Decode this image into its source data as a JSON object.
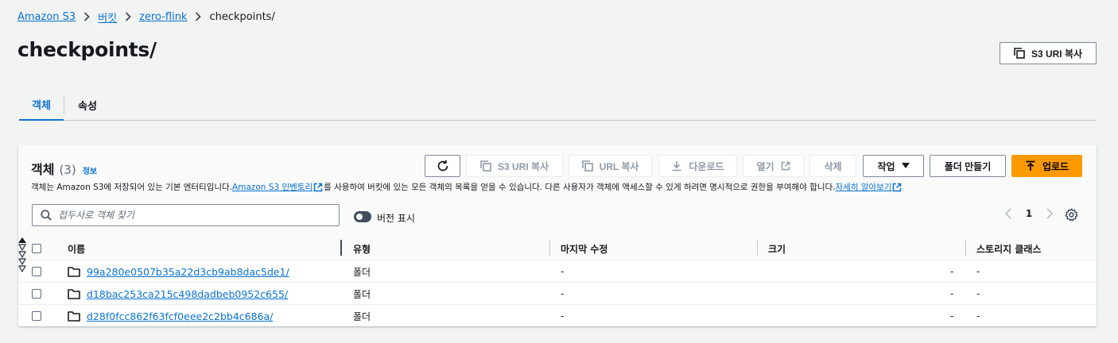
{
  "breadcrumb": [
    {
      "label": "Amazon S3",
      "link": true
    },
    {
      "label": "버킷",
      "link": true
    },
    {
      "label": "zero-flink",
      "link": true
    },
    {
      "label": "checkpoints/",
      "link": false
    }
  ],
  "page_title": "checkpoints/",
  "copy_s3_uri_label": "S3 URI 복사",
  "tabs": [
    {
      "label": "객체",
      "active": true
    },
    {
      "label": "속성",
      "active": false
    }
  ],
  "panel": {
    "title": "객체",
    "count": "(3)",
    "info": "정보",
    "description": {
      "before": "객체는 Amazon S3에 저장되어 있는 기본 엔터티입니다. ",
      "link1": "Amazon S3 인벤토리",
      "middle": "를 사용하여 버킷에 있는 모든 객체의 목록을 얻을 수 있습니다. 다른 사용자가 객체에 액세스할 수 있게 하려면 명시적으로 권한을 부여해야 합니다. ",
      "link2": "자세히 알아보기"
    },
    "toolbar": {
      "copy_s3_uri": "S3 URI 복사",
      "copy_url": "URL 복사",
      "download": "다운로드",
      "open": "열기",
      "delete": "삭제",
      "actions": "작업",
      "create_folder": "폴더 만들기",
      "upload": "업로드"
    },
    "search_placeholder": "접두사로 객체 찾기",
    "show_versions_label": "버전 표시",
    "current_page": "1"
  },
  "table": {
    "columns": [
      "이름",
      "유형",
      "마지막 수정",
      "크기",
      "스토리지 클래스"
    ],
    "rows": [
      {
        "name": "99a280e0507b35a22d3cb9ab8dac5de1/",
        "type": "폴더",
        "modified": "-",
        "size": "-",
        "storage": "-"
      },
      {
        "name": "d18bac253ca215c498dadbeb0952c655/",
        "type": "폴더",
        "modified": "-",
        "size": "-",
        "storage": "-"
      },
      {
        "name": "d28f0fcc862f63fcf0eee2c2bb4c686a/",
        "type": "폴더",
        "modified": "-",
        "size": "-",
        "storage": "-"
      }
    ]
  },
  "colors": {
    "link": "#0972d3",
    "primary_button": "#ff9900",
    "page_background": "#f2f3f3",
    "text": "#16191f"
  }
}
